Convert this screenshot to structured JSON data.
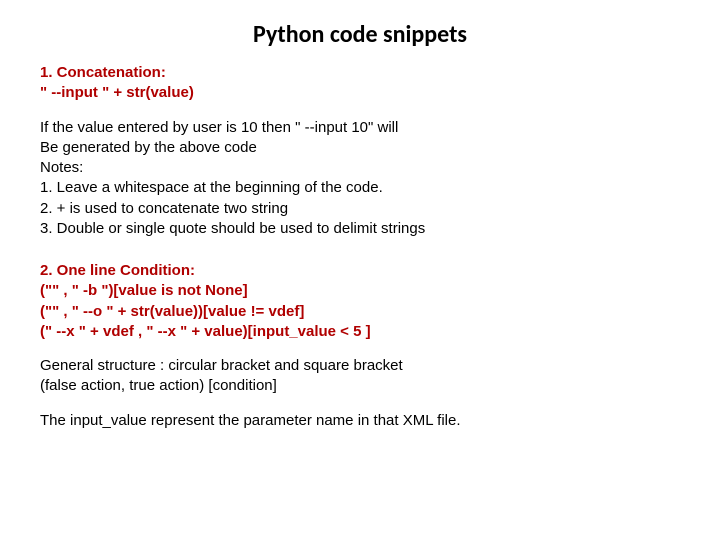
{
  "title": "Python code snippets",
  "section1": {
    "heading_line1": "1. Concatenation:",
    "heading_line2": "\" --input \" + str(value)",
    "body_line1": "If the value entered by user is 10 then \" --input 10\" will",
    "body_line2": "Be generated by the above code",
    "body_line3": "Notes:",
    "body_line4": "1. Leave a whitespace at the beginning of the code.",
    "body_line5": "2. + is used to concatenate two string",
    "body_line6": "3. Double or single quote should be used to delimit strings"
  },
  "section2": {
    "heading_line1": "2. One line Condition:",
    "heading_line2": "(\"\" , \" -b \")[value is not None]",
    "heading_line3": "(\"\" , \" --o \" + str(value))[value != vdef]",
    "heading_line4": "(\" --x \" + vdef , \" --x \" + value)[input_value < 5 ]",
    "body_line1": "General structure : circular bracket and square bracket",
    "body_line2": "(false action, true action) [condition]",
    "body_line3": "The input_value represent the parameter name in that XML file."
  }
}
